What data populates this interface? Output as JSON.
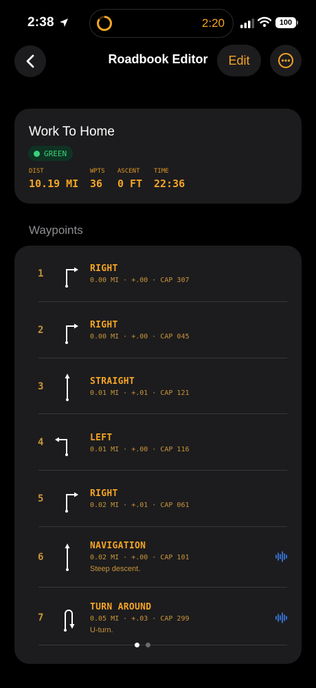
{
  "status_bar": {
    "time": "2:38",
    "timer": "2:20",
    "battery": "100"
  },
  "nav": {
    "title": "Roadbook Editor",
    "edit_label": "Edit"
  },
  "route": {
    "name": "Work To Home",
    "status": "GREEN",
    "stats": [
      {
        "label": "DIST",
        "value": "10.19 MI"
      },
      {
        "label": "WPTS",
        "value": "36"
      },
      {
        "label": "ASCENT",
        "value": "0 FT"
      },
      {
        "label": "TIME",
        "value": "22:36"
      }
    ]
  },
  "waypoints": {
    "section_title": "Waypoints",
    "items": [
      {
        "num": "1",
        "action": "RIGHT",
        "meta": "0.00 MI · +.00 · CAP 307",
        "note": "",
        "icon": "turn-right-icon",
        "audio": false
      },
      {
        "num": "2",
        "action": "RIGHT",
        "meta": "0.00 MI · +.00 · CAP 045",
        "note": "",
        "icon": "turn-right-icon",
        "audio": false
      },
      {
        "num": "3",
        "action": "STRAIGHT",
        "meta": "0.01 MI · +.01 · CAP 121",
        "note": "",
        "icon": "straight-arrow-icon",
        "audio": false
      },
      {
        "num": "4",
        "action": "LEFT",
        "meta": "0.01 MI · +.00 · CAP 116",
        "note": "",
        "icon": "turn-left-icon",
        "audio": false
      },
      {
        "num": "5",
        "action": "RIGHT",
        "meta": "0.02 MI · +.01 · CAP 061",
        "note": "",
        "icon": "turn-right-icon",
        "audio": false
      },
      {
        "num": "6",
        "action": "NAVIGATION",
        "meta": "0.02 MI · +.00 · CAP 101",
        "note": "Steep descent.",
        "icon": "straight-arrow-icon",
        "audio": true
      },
      {
        "num": "7",
        "action": "TURN AROUND",
        "meta": "0.05 MI · +.03 · CAP 299",
        "note": "U-turn.",
        "icon": "u-turn-icon",
        "audio": true
      }
    ]
  },
  "pager": {
    "count": 2,
    "active": 0
  },
  "colors": {
    "accent": "#f5a524",
    "status_green": "#3ad07a",
    "audio_blue": "#3b82f6"
  }
}
